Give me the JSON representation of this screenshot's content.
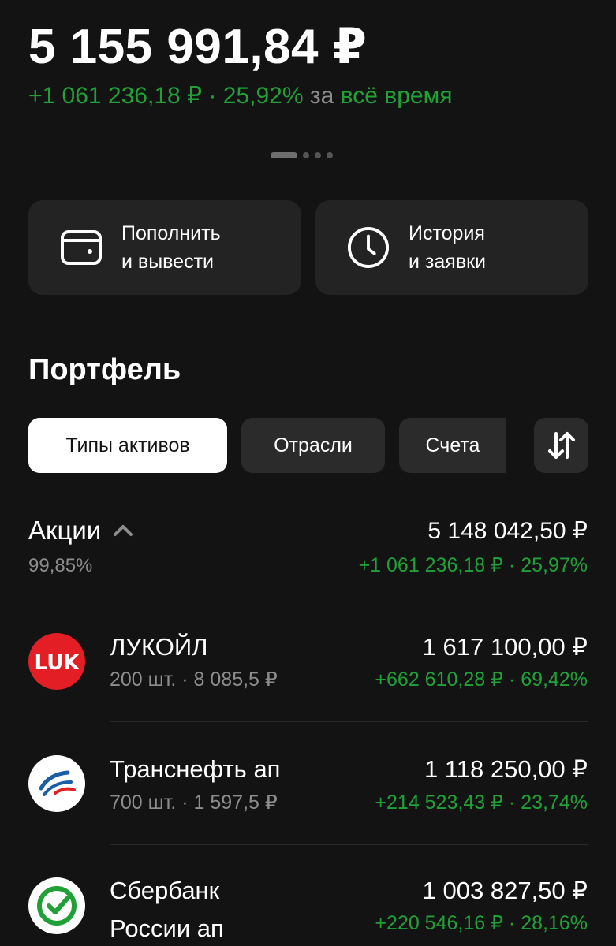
{
  "header": {
    "total": "5 155 991,84 ₽",
    "gain": "+1 061 236,18 ₽ · 25,92%",
    "period_prefix": "за",
    "period": "всё время"
  },
  "actions": [
    {
      "line1": "Пополнить",
      "line2": "и вывести",
      "icon": "wallet-icon"
    },
    {
      "line1": "История",
      "line2": "и заявки",
      "icon": "clock-icon"
    }
  ],
  "portfolio": {
    "title": "Портфель",
    "tabs": [
      "Типы активов",
      "Отрасли",
      "Счета"
    ],
    "active_tab": "Типы активов"
  },
  "group": {
    "name": "Акции",
    "share": "99,85%",
    "value": "5 148 042,50 ₽",
    "change": "+1 061 236,18 ₽ · 25,97%"
  },
  "assets": [
    {
      "name": "ЛУКОЙЛ",
      "sub": "200 шт. · 8 085,5 ₽",
      "value": "1 617 100,00 ₽",
      "change": "+662 610,28 ₽ · 69,42%",
      "logo_text": "LUK"
    },
    {
      "name": "Транснефть ап",
      "sub": "700 шт. · 1 597,5 ₽",
      "value": "1 118 250,00 ₽",
      "change": "+214 523,43 ₽ · 23,74%"
    },
    {
      "name": "Сбербанк",
      "name2": "России ап",
      "value": "1 003 827,50 ₽",
      "change": "+220 546,16 ₽ · 28,16%"
    }
  ],
  "colors": {
    "background": "#131313",
    "positive": "#21a038",
    "card": "#232323",
    "lukoil_red": "#e31e24"
  }
}
